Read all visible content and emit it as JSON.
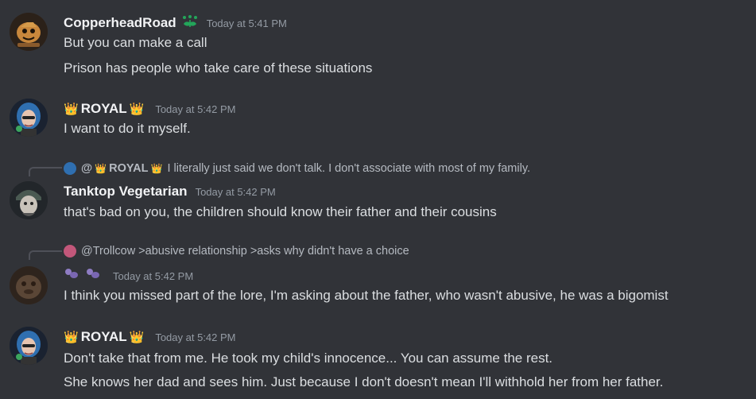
{
  "messages": [
    {
      "author": "CopperheadRoad",
      "time": "Today at 5:41 PM",
      "lines": [
        "But you can make a call",
        "Prison has people who take care of these situations"
      ]
    },
    {
      "author": "ROYAL",
      "time": "Today at 5:42 PM",
      "lines": [
        "I want to do it myself."
      ]
    },
    {
      "reply_to": "@",
      "reply_author": "ROYAL",
      "reply_text": "I literally just said we don't talk. I don't associate with most of my family.",
      "author": "Tanktop Vegetarian",
      "time": "Today at 5:42 PM",
      "lines": [
        "that's bad on you, the children should know their father and their cousins"
      ]
    },
    {
      "reply_to": "@Trollcow",
      "reply_text": ">abusive relationship >asks why didn't have a choice",
      "author": "",
      "time": "Today at 5:42 PM",
      "lines": [
        "I think you missed part of the lore, I'm asking about the father, who wasn't abusive, he was a bigomist"
      ]
    },
    {
      "author": "ROYAL",
      "time": "Today at 5:42 PM",
      "lines": [
        "Don't take that from me. He took my child's innocence... You can assume the rest.",
        "She knows her dad and sees him. Just because I don't doesn't mean I'll withhold her from her father."
      ]
    }
  ],
  "colors": {
    "background": "#313338",
    "text": "#dbdee1",
    "username": "#f2f3f5",
    "timestamp": "#949ba4",
    "crown": "#f0b232",
    "badge_green": "#23a55a",
    "anon_purple": "#8e7cc3"
  },
  "icons": {
    "crown": "crown-icon",
    "leaf_badge": "leaf-badge-icon",
    "anon_name": "purple-blob-icon"
  }
}
